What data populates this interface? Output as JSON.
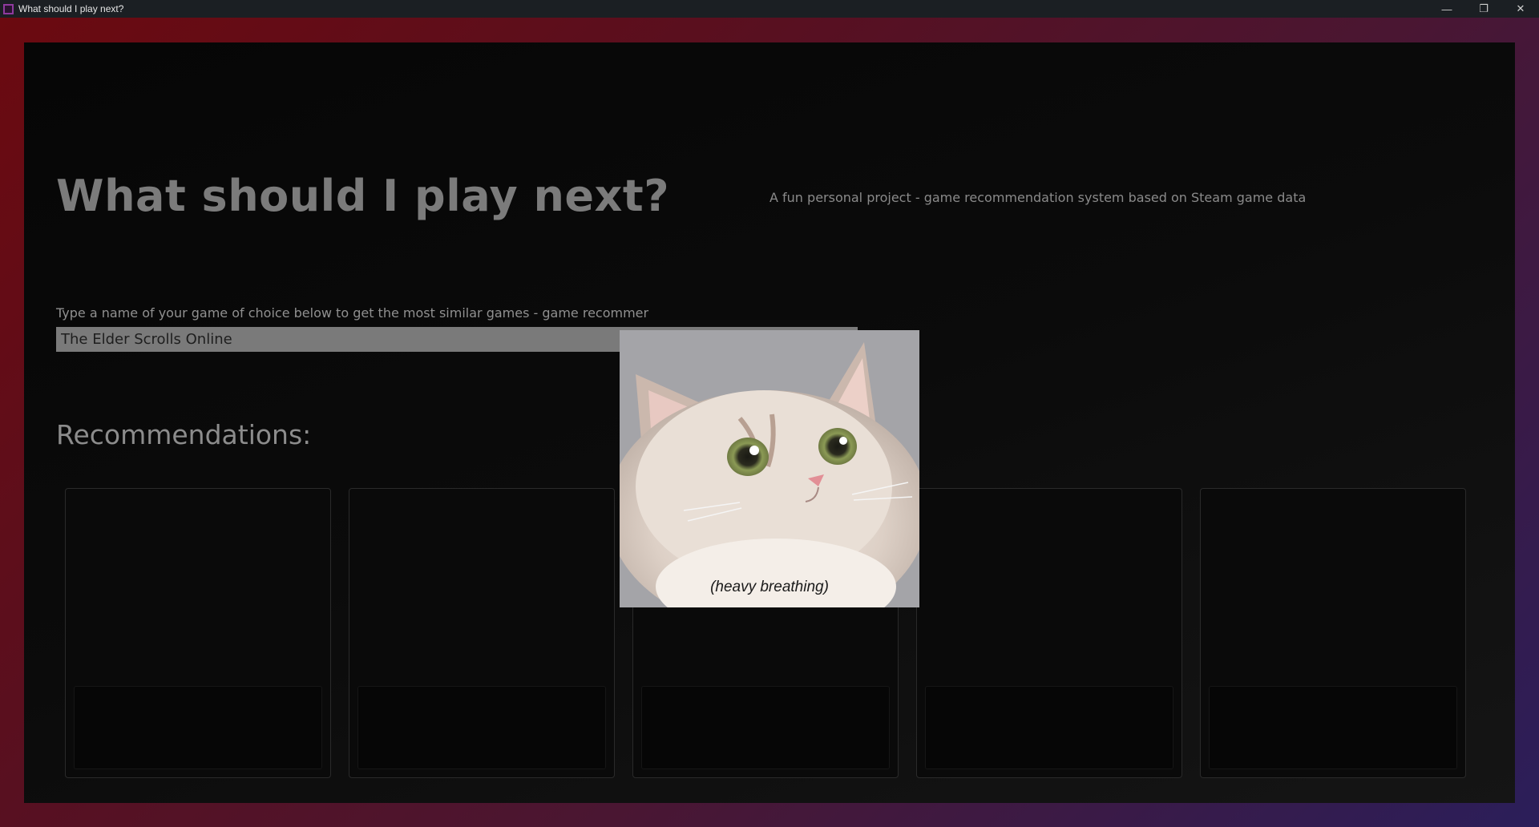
{
  "window": {
    "title": "What should I play next?",
    "controls": {
      "minimize": "—",
      "restore": "❐",
      "close": "✕"
    }
  },
  "header": {
    "title": "What should I play next?",
    "subtitle": "A fun personal project - game recommendation system based on Steam game data"
  },
  "search": {
    "prompt": "Type a name of your game of choice below to get the most similar games - game recommer",
    "value": "The Elder Scrolls Online"
  },
  "recommendations": {
    "heading": "Recommendations:",
    "card_count": 5
  },
  "popup": {
    "caption": "(heavy breathing)",
    "image": "cat-meme"
  },
  "colors": {
    "frame_start": "#6b0a10",
    "frame_end": "#2b1e5a",
    "panel": "#0b0b0b",
    "heading": "#7b7b7b",
    "input_bg": "#7a7a7a"
  }
}
